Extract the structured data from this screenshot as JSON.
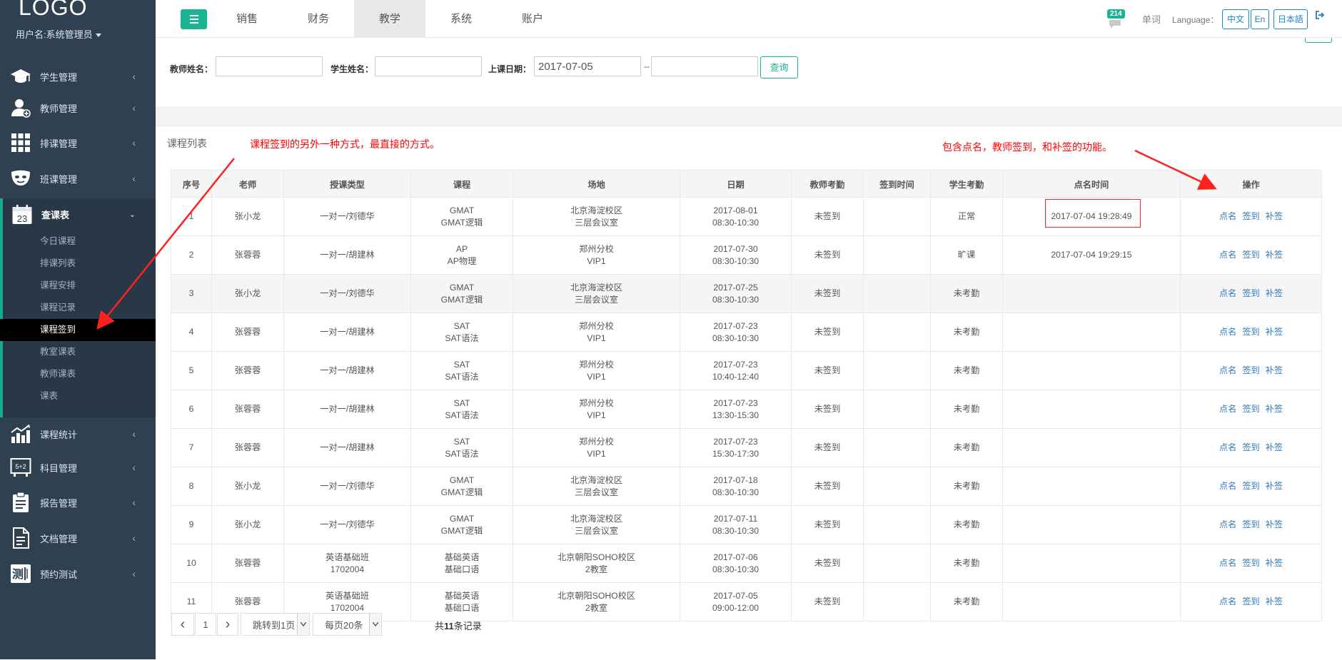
{
  "sidebar": {
    "logo": "LOGO",
    "user": "用户名:系统管理员",
    "menu": [
      {
        "label": "学生管理",
        "icon": "graduation-cap-icon"
      },
      {
        "label": "教师管理",
        "icon": "teacher-icon"
      },
      {
        "label": "排课管理",
        "icon": "grid-icon"
      },
      {
        "label": "班课管理",
        "icon": "mask-icon"
      },
      {
        "label": "查课表",
        "icon": "calendar-icon",
        "date": "23"
      },
      {
        "label": "课程统计",
        "icon": "chart-icon"
      },
      {
        "label": "科目管理",
        "icon": "blackboard-icon"
      },
      {
        "label": "报告管理",
        "icon": "clipboard-icon"
      },
      {
        "label": "文档管理",
        "icon": "document-icon"
      },
      {
        "label": "预约测试",
        "icon": "test-icon",
        "glyph": "测"
      }
    ],
    "submenu": [
      "今日课程",
      "排课列表",
      "课程安排",
      "课程记录",
      "课程签到",
      "教室课表",
      "教师课表",
      "课表"
    ],
    "active_submenu": "课程签到"
  },
  "topbar": {
    "tabs": [
      "销售",
      "财务",
      "教学",
      "系统",
      "账户"
    ],
    "active_tab": "教学",
    "notification_count": "214",
    "word_link": "单词",
    "language_label": "Language：",
    "languages": [
      "中文",
      "En",
      "日本語"
    ]
  },
  "search": {
    "teacher_label": "教师姓名：",
    "student_label": "学生姓名：",
    "date_label": "上课日期：",
    "date_from": "2017-07-05",
    "date_to": "",
    "separator": "--",
    "query_button": "查询"
  },
  "list": {
    "title": "课程列表",
    "annotation_left": "课程签到的另外一种方式，最直接的方式。",
    "annotation_right": "包含点名，教师签到，和补签的功能。",
    "columns": [
      "序号",
      "老师",
      "授课类型",
      "课程",
      "场地",
      "日期",
      "教师考勤",
      "签到时间",
      "学生考勤",
      "点名时间",
      "操作"
    ],
    "actions": [
      "点名",
      "签到",
      "补签"
    ],
    "rows": [
      {
        "no": "1",
        "teacher": "张小龙",
        "type1": "一对一/刘德华",
        "type2": "",
        "course1": "GMAT",
        "course2": "GMAT逻辑",
        "venue1": "北京海淀校区",
        "venue2": "三层会议室",
        "date": "2017-08-01",
        "time": "08:30-10:30",
        "t_att": "未签到",
        "sign_time": "",
        "s_att": "正常",
        "roll_time": "2017-07-04 19:28:49"
      },
      {
        "no": "2",
        "teacher": "张蓉蓉",
        "type1": "一对一/胡建林",
        "type2": "",
        "course1": "AP",
        "course2": "AP物理",
        "venue1": "郑州分校",
        "venue2": "VIP1",
        "date": "2017-07-30",
        "time": "08:30-10:30",
        "t_att": "未签到",
        "sign_time": "",
        "s_att": "旷课",
        "roll_time": "2017-07-04 19:29:15"
      },
      {
        "no": "3",
        "teacher": "张小龙",
        "type1": "一对一/刘德华",
        "type2": "",
        "course1": "GMAT",
        "course2": "GMAT逻辑",
        "venue1": "北京海淀校区",
        "venue2": "三层会议室",
        "date": "2017-07-25",
        "time": "08:30-10:30",
        "t_att": "未签到",
        "sign_time": "",
        "s_att": "未考勤",
        "roll_time": ""
      },
      {
        "no": "4",
        "teacher": "张蓉蓉",
        "type1": "一对一/胡建林",
        "type2": "",
        "course1": "SAT",
        "course2": "SAT语法",
        "venue1": "郑州分校",
        "venue2": "VIP1",
        "date": "2017-07-23",
        "time": "08:30-10:30",
        "t_att": "未签到",
        "sign_time": "",
        "s_att": "未考勤",
        "roll_time": ""
      },
      {
        "no": "5",
        "teacher": "张蓉蓉",
        "type1": "一对一/胡建林",
        "type2": "",
        "course1": "SAT",
        "course2": "SAT语法",
        "venue1": "郑州分校",
        "venue2": "VIP1",
        "date": "2017-07-23",
        "time": "10:40-12:40",
        "t_att": "未签到",
        "sign_time": "",
        "s_att": "未考勤",
        "roll_time": ""
      },
      {
        "no": "6",
        "teacher": "张蓉蓉",
        "type1": "一对一/胡建林",
        "type2": "",
        "course1": "SAT",
        "course2": "SAT语法",
        "venue1": "郑州分校",
        "venue2": "VIP1",
        "date": "2017-07-23",
        "time": "13:30-15:30",
        "t_att": "未签到",
        "sign_time": "",
        "s_att": "未考勤",
        "roll_time": ""
      },
      {
        "no": "7",
        "teacher": "张蓉蓉",
        "type1": "一对一/胡建林",
        "type2": "",
        "course1": "SAT",
        "course2": "SAT语法",
        "venue1": "郑州分校",
        "venue2": "VIP1",
        "date": "2017-07-23",
        "time": "15:30-17:30",
        "t_att": "未签到",
        "sign_time": "",
        "s_att": "未考勤",
        "roll_time": ""
      },
      {
        "no": "8",
        "teacher": "张小龙",
        "type1": "一对一/刘德华",
        "type2": "",
        "course1": "GMAT",
        "course2": "GMAT逻辑",
        "venue1": "北京海淀校区",
        "venue2": "三层会议室",
        "date": "2017-07-18",
        "time": "08:30-10:30",
        "t_att": "未签到",
        "sign_time": "",
        "s_att": "未考勤",
        "roll_time": ""
      },
      {
        "no": "9",
        "teacher": "张小龙",
        "type1": "一对一/刘德华",
        "type2": "",
        "course1": "GMAT",
        "course2": "GMAT逻辑",
        "venue1": "北京海淀校区",
        "venue2": "三层会议室",
        "date": "2017-07-11",
        "time": "08:30-10:30",
        "t_att": "未签到",
        "sign_time": "",
        "s_att": "未考勤",
        "roll_time": ""
      },
      {
        "no": "10",
        "teacher": "张蓉蓉",
        "type1": "英语基础班",
        "type2": "1702004",
        "course1": "基础英语",
        "course2": "基础口语",
        "venue1": "北京朝阳SOHO校区",
        "venue2": "2教室",
        "date": "2017-07-06",
        "time": "08:30-10:30",
        "t_att": "未签到",
        "sign_time": "",
        "s_att": "未考勤",
        "roll_time": ""
      },
      {
        "no": "11",
        "teacher": "张蓉蓉",
        "type1": "英语基础班",
        "type2": "1702004",
        "course1": "基础英语",
        "course2": "基础口语",
        "venue1": "北京朝阳SOHO校区",
        "venue2": "2教室",
        "date": "2017-07-05",
        "time": "09:00-12:00",
        "t_att": "未签到",
        "sign_time": "",
        "s_att": "未考勤",
        "roll_time": ""
      }
    ]
  },
  "pagination": {
    "prev": "‹",
    "page": "1",
    "next": "›",
    "jump": "跳转到1页",
    "per_page": "每页20条",
    "total_prefix": "共",
    "total_count": "11",
    "total_suffix": "条记录"
  },
  "colors": {
    "sidebar_bg": "#2f4050",
    "accent": "#1ab394",
    "link": "#337ab7",
    "annotation": "#ff0000"
  }
}
